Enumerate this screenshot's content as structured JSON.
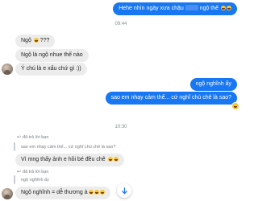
{
  "messages": {
    "m1": {
      "pre": "Hehe nhìn ngày xưa chậu ",
      "post": " ngộ thế"
    },
    "time1": "09:44",
    "m2": {
      "pre": "Ngộ ",
      "post": " ???"
    },
    "m3": "Ngộ là ngộ nhue thế nào",
    "m4": "Ý chú là e xấu chứ gì :))",
    "m5": "ngộ nghĩnh ấy",
    "m6": "sao em nhạy cảm thế... cứ nghĩ chú chê là sao?",
    "time2": "10:30",
    "reply1": {
      "label": "đã trả lời bạn",
      "quoted": "sao em nhạy cảm thế... cứ nghĩ chú chê là sao?"
    },
    "m7": "Vì mng thấy ảnh e hồi bé đều chê ",
    "reply2": {
      "label": "đã trả lời bạn",
      "quoted": "ngộ nghĩnh ấy"
    },
    "m8": "Ngộ nghĩnh = dễ thương à"
  },
  "icons": {
    "emoji": "laughing-face-icon",
    "scroll": "arrow-down-icon",
    "reply": "reply-arrow-icon"
  },
  "colors": {
    "outgoing": "#1877f2",
    "incoming": "#ececec"
  }
}
